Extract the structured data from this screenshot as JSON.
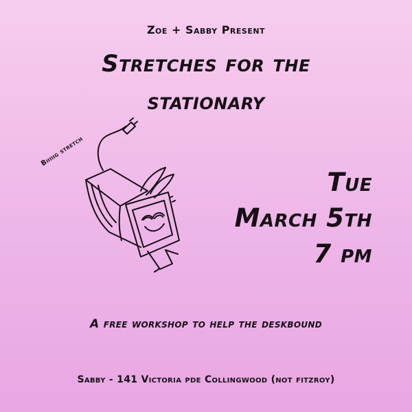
{
  "poster": {
    "presenters": "Zoe + Sabby Present",
    "title_line_1": "Stretches for the",
    "title_line_2": "stationary",
    "day": "Tue",
    "date": "March 5th",
    "time": "7 pm",
    "illustration_label": "Biiiiig stretch",
    "tagline": "A free workshop to help the deskbound",
    "address": "Sabby - 141 Victoria pde Collingwood (not fitzroy)"
  },
  "colors": {
    "background_top": "#f6cdee",
    "background_bottom": "#e8a7e3",
    "ink": "#141014"
  },
  "icons": {
    "illustration": "stretching-computer-monitor-drawing"
  }
}
